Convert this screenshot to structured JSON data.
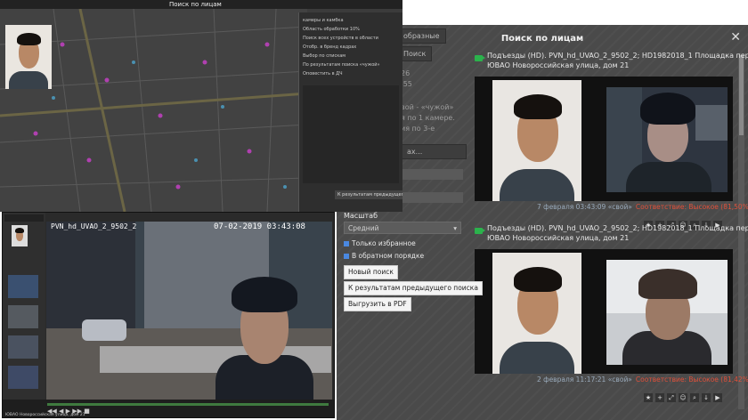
{
  "right_panel": {
    "title": "Поиск по лицам",
    "bg_button": "образные",
    "bg_button2": "Поиск",
    "bg_lines": [
      "26",
      ":55",
      "вой - «чужой»",
      "я по 1 камере.",
      "ия по 3-е"
    ],
    "bg_button3": "ах..."
  },
  "results": [
    {
      "line1": "Подъезды (HD). PVN_hd_UVAO_2_9502_2; HD1982018_1 Площадка перед подъе",
      "line2": "ЮВАО Новороссийская улица, дом 21",
      "meta": "7 февраля 03:43:09 «свой»",
      "confidence": "Соответствие: Высокое (81,50%)"
    },
    {
      "line1": "Подъезды (HD). PVN_hd_UVAO_2_9502_2; HD1982018_1 Площадка перед подъе",
      "line2": "ЮВАО Новороссийская улица, дом 21",
      "meta": "2 февраля 11:17:21 «свой»",
      "confidence": "Соответствие: Высокое (81,42%)"
    }
  ],
  "form": {
    "scale_label": "Масштаб",
    "scale_value": "Средний",
    "only_favorites": "Только избранное",
    "reverse_order": "В обратном порядке",
    "new_search": "Новый поиск",
    "prev_results": "К результатам предыдущего поиска",
    "export_pdf": "Выгрузить в PDF"
  },
  "top_left": {
    "title": "Поиск по лицам",
    "rows": [
      "камеры и камбка",
      "Область обработки 10%",
      "Поиск всех устройств в области",
      "Отобр. в бренд кадрах",
      "Выбор по спискам",
      "По результатам поиска «чужой»",
      "Оповестить в ДЧ"
    ],
    "bottom_button": "К результатам предыдущего поиска"
  },
  "bottom_left": {
    "camera_id": "PVN_hd_UVAO_2_9502_2",
    "timestamp": "07-02-2019 03:43:08",
    "caption": "ЮВАО Новороссийская улица, дом 21"
  }
}
